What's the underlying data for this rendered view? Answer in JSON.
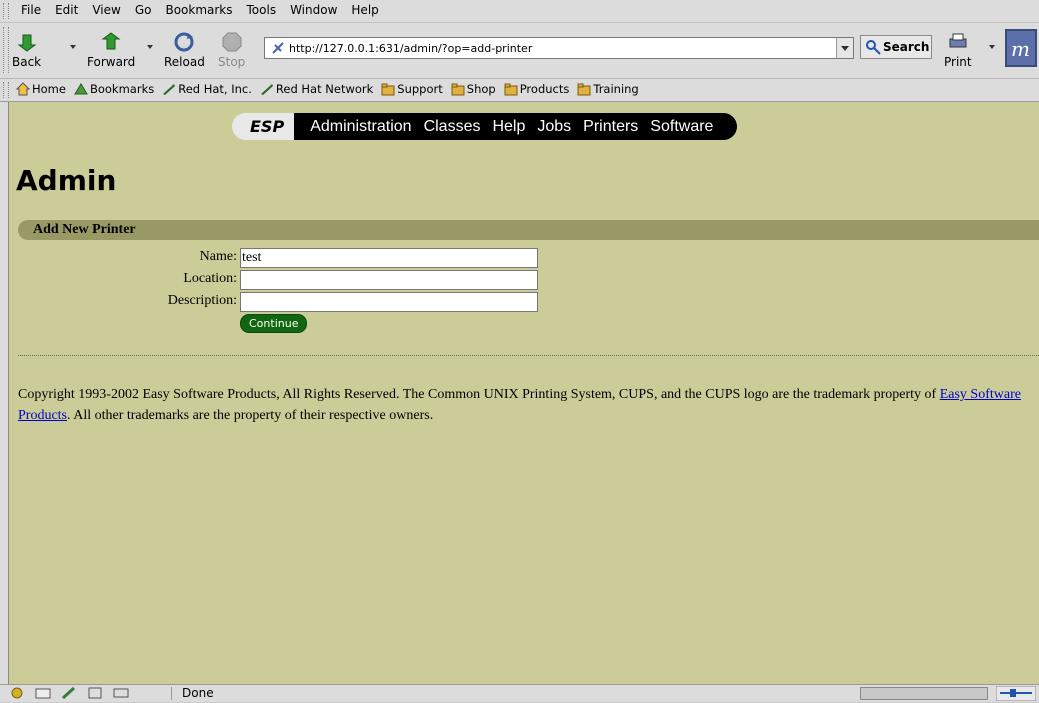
{
  "menubar": {
    "items": [
      "File",
      "Edit",
      "View",
      "Go",
      "Bookmarks",
      "Tools",
      "Window",
      "Help"
    ]
  },
  "toolbar": {
    "back_label": "Back",
    "forward_label": "Forward",
    "reload_label": "Reload",
    "stop_label": "Stop",
    "url": "http://127.0.0.1:631/admin/?op=add-printer",
    "search_label": "Search",
    "print_label": "Print"
  },
  "bookmarks": {
    "items": [
      {
        "label": "Home",
        "icon": "home-icon"
      },
      {
        "label": "Bookmarks",
        "icon": "bookmarks-icon"
      },
      {
        "label": "Red Hat, Inc.",
        "icon": "redhat-icon"
      },
      {
        "label": "Red Hat Network",
        "icon": "redhat-icon"
      },
      {
        "label": "Support",
        "icon": "folder-icon"
      },
      {
        "label": "Shop",
        "icon": "folder-icon"
      },
      {
        "label": "Products",
        "icon": "folder-icon"
      },
      {
        "label": "Training",
        "icon": "folder-icon"
      }
    ]
  },
  "cups_nav": {
    "logo": "ESP",
    "links": [
      "Administration",
      "Classes",
      "Help",
      "Jobs",
      "Printers",
      "Software"
    ]
  },
  "page": {
    "title": "Admin",
    "section_title": "Add New Printer",
    "form": {
      "name_label": "Name:",
      "name_value": "test",
      "location_label": "Location:",
      "location_value": "",
      "description_label": "Description:",
      "description_value": "",
      "continue_label": "Continue"
    },
    "copyright_prefix": "Copyright 1993-2002 Easy Software Products, All Rights Reserved. The Common UNIX Printing System, CUPS, and the CUPS logo are the trademark property of ",
    "copyright_link": "Easy Software Products",
    "copyright_suffix": ". All other trademarks are the property of their respective owners."
  },
  "statusbar": {
    "text": "Done"
  },
  "colors": {
    "content_bg": "#cccc99",
    "section_bar": "#999966",
    "continue_button": "#116611"
  }
}
